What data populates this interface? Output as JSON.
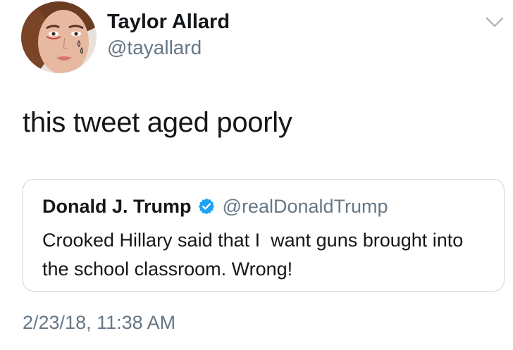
{
  "tweet": {
    "author": {
      "display_name": "Taylor Allard",
      "handle": "@tayallard"
    },
    "menu_icon": "chevron-down-icon",
    "text": "this tweet aged poorly",
    "timestamp": "2/23/18, 11:38 AM"
  },
  "quoted_tweet": {
    "author": {
      "display_name": "Donald J. Trump",
      "verified_icon": "verified-badge-icon",
      "handle": "@realDonaldTrump"
    },
    "text": "Crooked Hillary said that I  want guns brought into the school classroom. Wrong!"
  },
  "colors": {
    "primary_text": "#14171a",
    "secondary_text": "#657786",
    "verified_blue": "#1da1f2",
    "border": "#ccd6dd"
  }
}
